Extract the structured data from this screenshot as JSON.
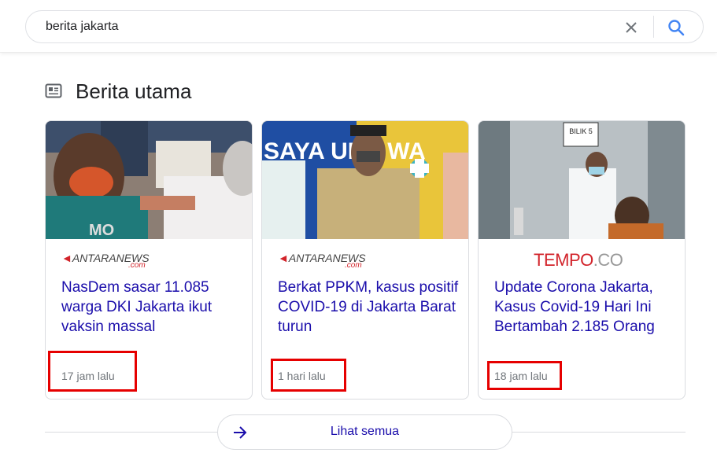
{
  "search": {
    "query": "berita jakarta",
    "clear_icon": "close-icon",
    "search_icon": "search-icon"
  },
  "section": {
    "title": "Berita utama",
    "icon": "newspaper-icon"
  },
  "cards": [
    {
      "source_logo_text": "ANTARANEWS",
      "source_logo_suffix": ".com",
      "headline": "NasDem sasar 11.085 warga DKI Jakarta ikut vaksin massal",
      "time": "17 jam lalu"
    },
    {
      "source_logo_text": "ANTARANEWS",
      "source_logo_suffix": ".com",
      "headline": "Berkat PPKM, kasus positif COVID-19 di Jakarta Barat turun",
      "time": "1 hari lalu",
      "image_sign": "SAYA UDA WA"
    },
    {
      "source_logo_text": "TEMPO",
      "source_logo_suffix": ".CO",
      "headline": "Update Corona Jakarta, Kasus Covid-19 Hari Ini Bertambah 2.185 Orang",
      "time": "18 jam lalu",
      "image_sign": "BILIK 5"
    }
  ],
  "see_all": {
    "label": "Lihat semua",
    "icon": "arrow-right-icon"
  },
  "colors": {
    "link": "#1a0dab",
    "meta": "#70757a",
    "highlight": "#e60000",
    "search_blue": "#4285f4",
    "antara_red": "#d2232a"
  }
}
